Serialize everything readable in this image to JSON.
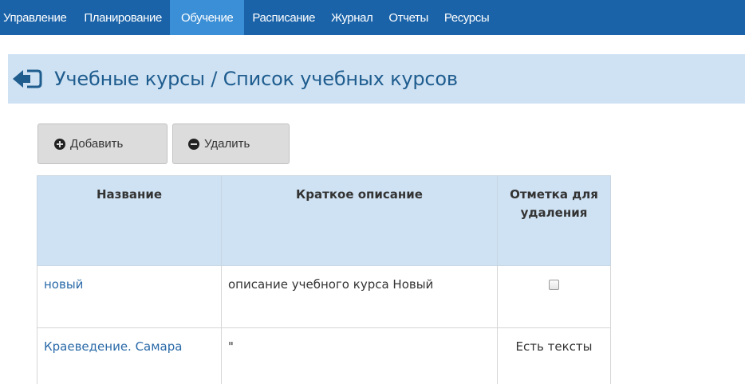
{
  "nav": {
    "items": [
      {
        "label": "Управление",
        "active": false
      },
      {
        "label": "Планирование",
        "active": false
      },
      {
        "label": "Обучение",
        "active": true
      },
      {
        "label": "Расписание",
        "active": false
      },
      {
        "label": "Журнал",
        "active": false
      },
      {
        "label": "Отчеты",
        "active": false
      },
      {
        "label": "Ресурсы",
        "active": false
      }
    ]
  },
  "header": {
    "back_icon": "back-arrow-icon",
    "title": "Учебные курсы / Список учебных курсов"
  },
  "toolbar": {
    "add_label": "Добавить",
    "add_icon": "plus-circle-icon",
    "delete_label": "Удалить",
    "delete_icon": "minus-circle-icon"
  },
  "table": {
    "columns": [
      "Название",
      "Краткое описание",
      "Отметка для удаления"
    ],
    "rows": [
      {
        "name": "новый",
        "description": "описание учебного курса Новый",
        "delete_mark": "",
        "checked": false
      },
      {
        "name": "Краеведение. Самара",
        "description": "\"",
        "delete_mark": "Есть тексты"
      }
    ]
  },
  "colors": {
    "nav_bg": "#1a63a9",
    "nav_active": "#3b8fd6",
    "title_bg": "#cfe2f3",
    "title_text": "#1f5d8f",
    "link": "#2a6aa8"
  }
}
